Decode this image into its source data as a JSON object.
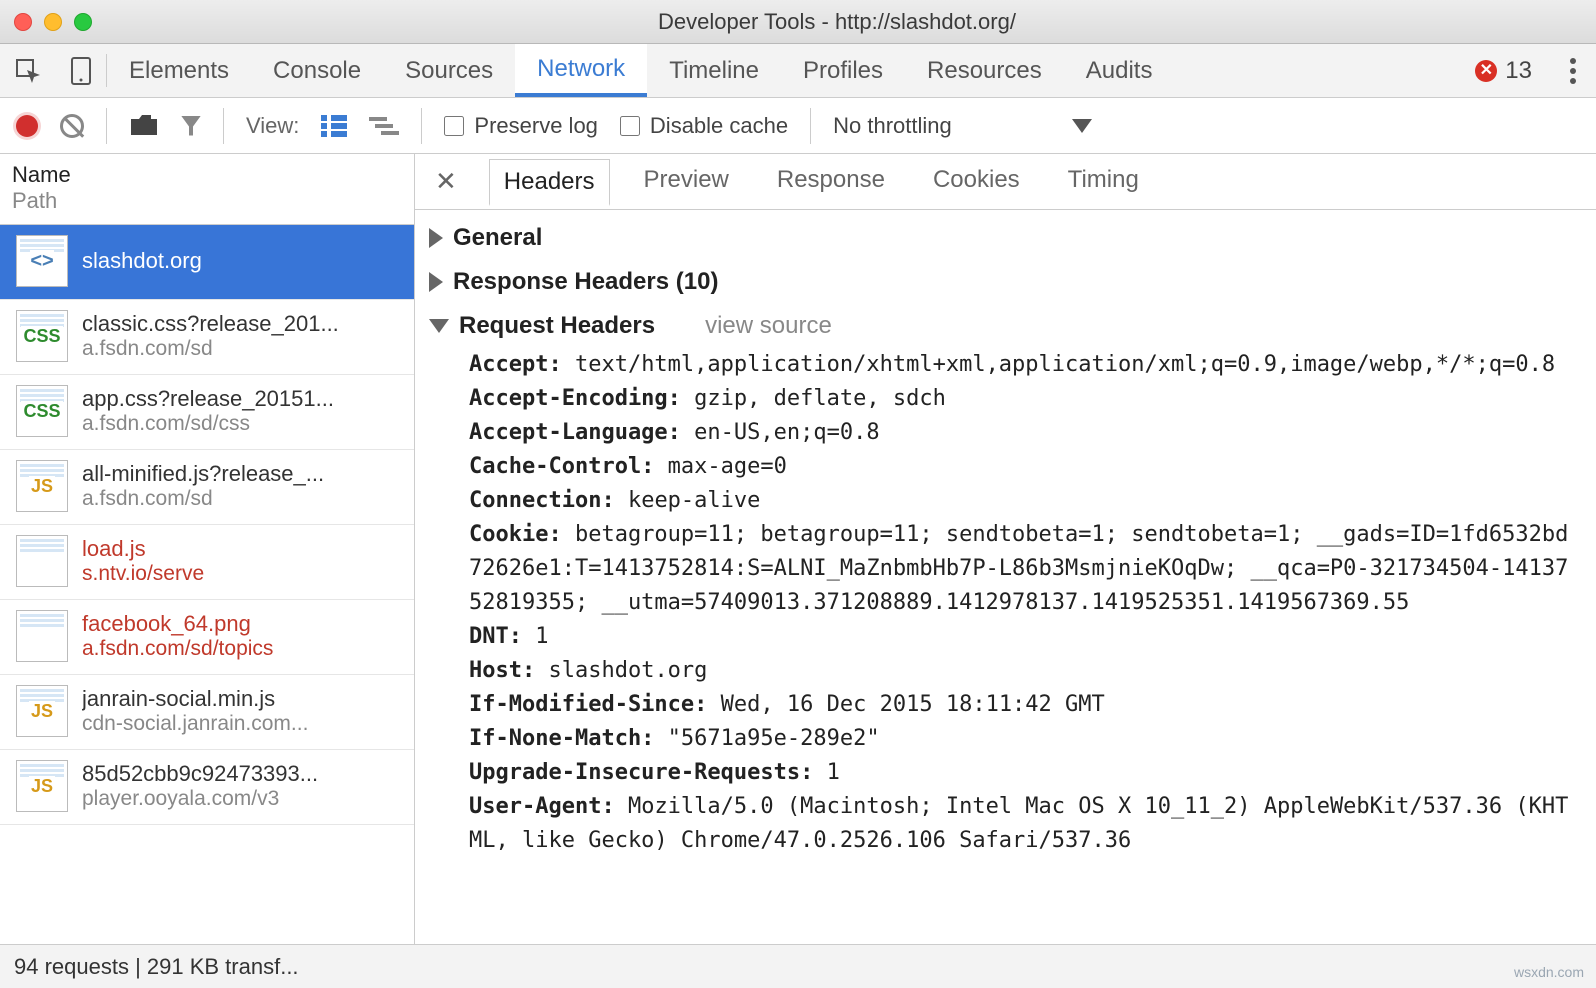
{
  "window": {
    "title": "Developer Tools - http://slashdot.org/"
  },
  "mainTabs": {
    "items": [
      "Elements",
      "Console",
      "Sources",
      "Network",
      "Timeline",
      "Profiles",
      "Resources",
      "Audits"
    ],
    "active": "Network",
    "errorCount": "13"
  },
  "toolbar": {
    "viewLabel": "View:",
    "preserveLog": "Preserve log",
    "disableCache": "Disable cache",
    "throttling": "No throttling"
  },
  "sidebar": {
    "headName": "Name",
    "headPath": "Path",
    "items": [
      {
        "icon": "html",
        "name": "slashdot.org",
        "path": "",
        "selected": true,
        "error": false
      },
      {
        "icon": "css",
        "name": "classic.css?release_201...",
        "path": "a.fsdn.com/sd",
        "selected": false,
        "error": false
      },
      {
        "icon": "css",
        "name": "app.css?release_20151...",
        "path": "a.fsdn.com/sd/css",
        "selected": false,
        "error": false
      },
      {
        "icon": "js",
        "name": "all-minified.js?release_...",
        "path": "a.fsdn.com/sd",
        "selected": false,
        "error": false
      },
      {
        "icon": "blank",
        "name": "load.js",
        "path": "s.ntv.io/serve",
        "selected": false,
        "error": true
      },
      {
        "icon": "blank",
        "name": "facebook_64.png",
        "path": "a.fsdn.com/sd/topics",
        "selected": false,
        "error": true
      },
      {
        "icon": "js",
        "name": "janrain-social.min.js",
        "path": "cdn-social.janrain.com...",
        "selected": false,
        "error": false
      },
      {
        "icon": "js",
        "name": "85d52cbb9c92473393...",
        "path": "player.ooyala.com/v3",
        "selected": false,
        "error": false
      }
    ]
  },
  "detail": {
    "tabs": [
      "Headers",
      "Preview",
      "Response",
      "Cookies",
      "Timing"
    ],
    "active": "Headers",
    "general": "General",
    "responseHeaders": "Response Headers (10)",
    "requestHeaders": "Request Headers",
    "viewSource": "view source",
    "headers": [
      {
        "k": "Accept:",
        "v": "text/html,application/xhtml+xml,application/xml;q=0.9,image/webp,*/*;q=0.8"
      },
      {
        "k": "Accept-Encoding:",
        "v": "gzip, deflate, sdch"
      },
      {
        "k": "Accept-Language:",
        "v": "en-US,en;q=0.8"
      },
      {
        "k": "Cache-Control:",
        "v": "max-age=0"
      },
      {
        "k": "Connection:",
        "v": "keep-alive"
      },
      {
        "k": "Cookie:",
        "v": "betagroup=11; betagroup=11; sendtobeta=1; sendtobeta=1; __gads=ID=1fd6532bd72626e1:T=1413752814:S=ALNI_MaZnbmbHb7P-L86b3MsmjnieKOqDw; __qca=P0-321734504-1413752819355; __utma=57409013.371208889.1412978137.1419525351.1419567369.55"
      },
      {
        "k": "DNT:",
        "v": "1"
      },
      {
        "k": "Host:",
        "v": "slashdot.org"
      },
      {
        "k": "If-Modified-Since:",
        "v": "Wed, 16 Dec 2015 18:11:42 GMT"
      },
      {
        "k": "If-None-Match:",
        "v": "\"5671a95e-289e2\""
      },
      {
        "k": "Upgrade-Insecure-Requests:",
        "v": "1"
      },
      {
        "k": "User-Agent:",
        "v": "Mozilla/5.0 (Macintosh; Intel Mac OS X 10_11_2) AppleWebKit/537.36 (KHTML, like Gecko) Chrome/47.0.2526.106 Safari/537.36"
      }
    ]
  },
  "status": {
    "text": "94 requests | 291 KB transf..."
  },
  "watermark": "wsxdn.com"
}
